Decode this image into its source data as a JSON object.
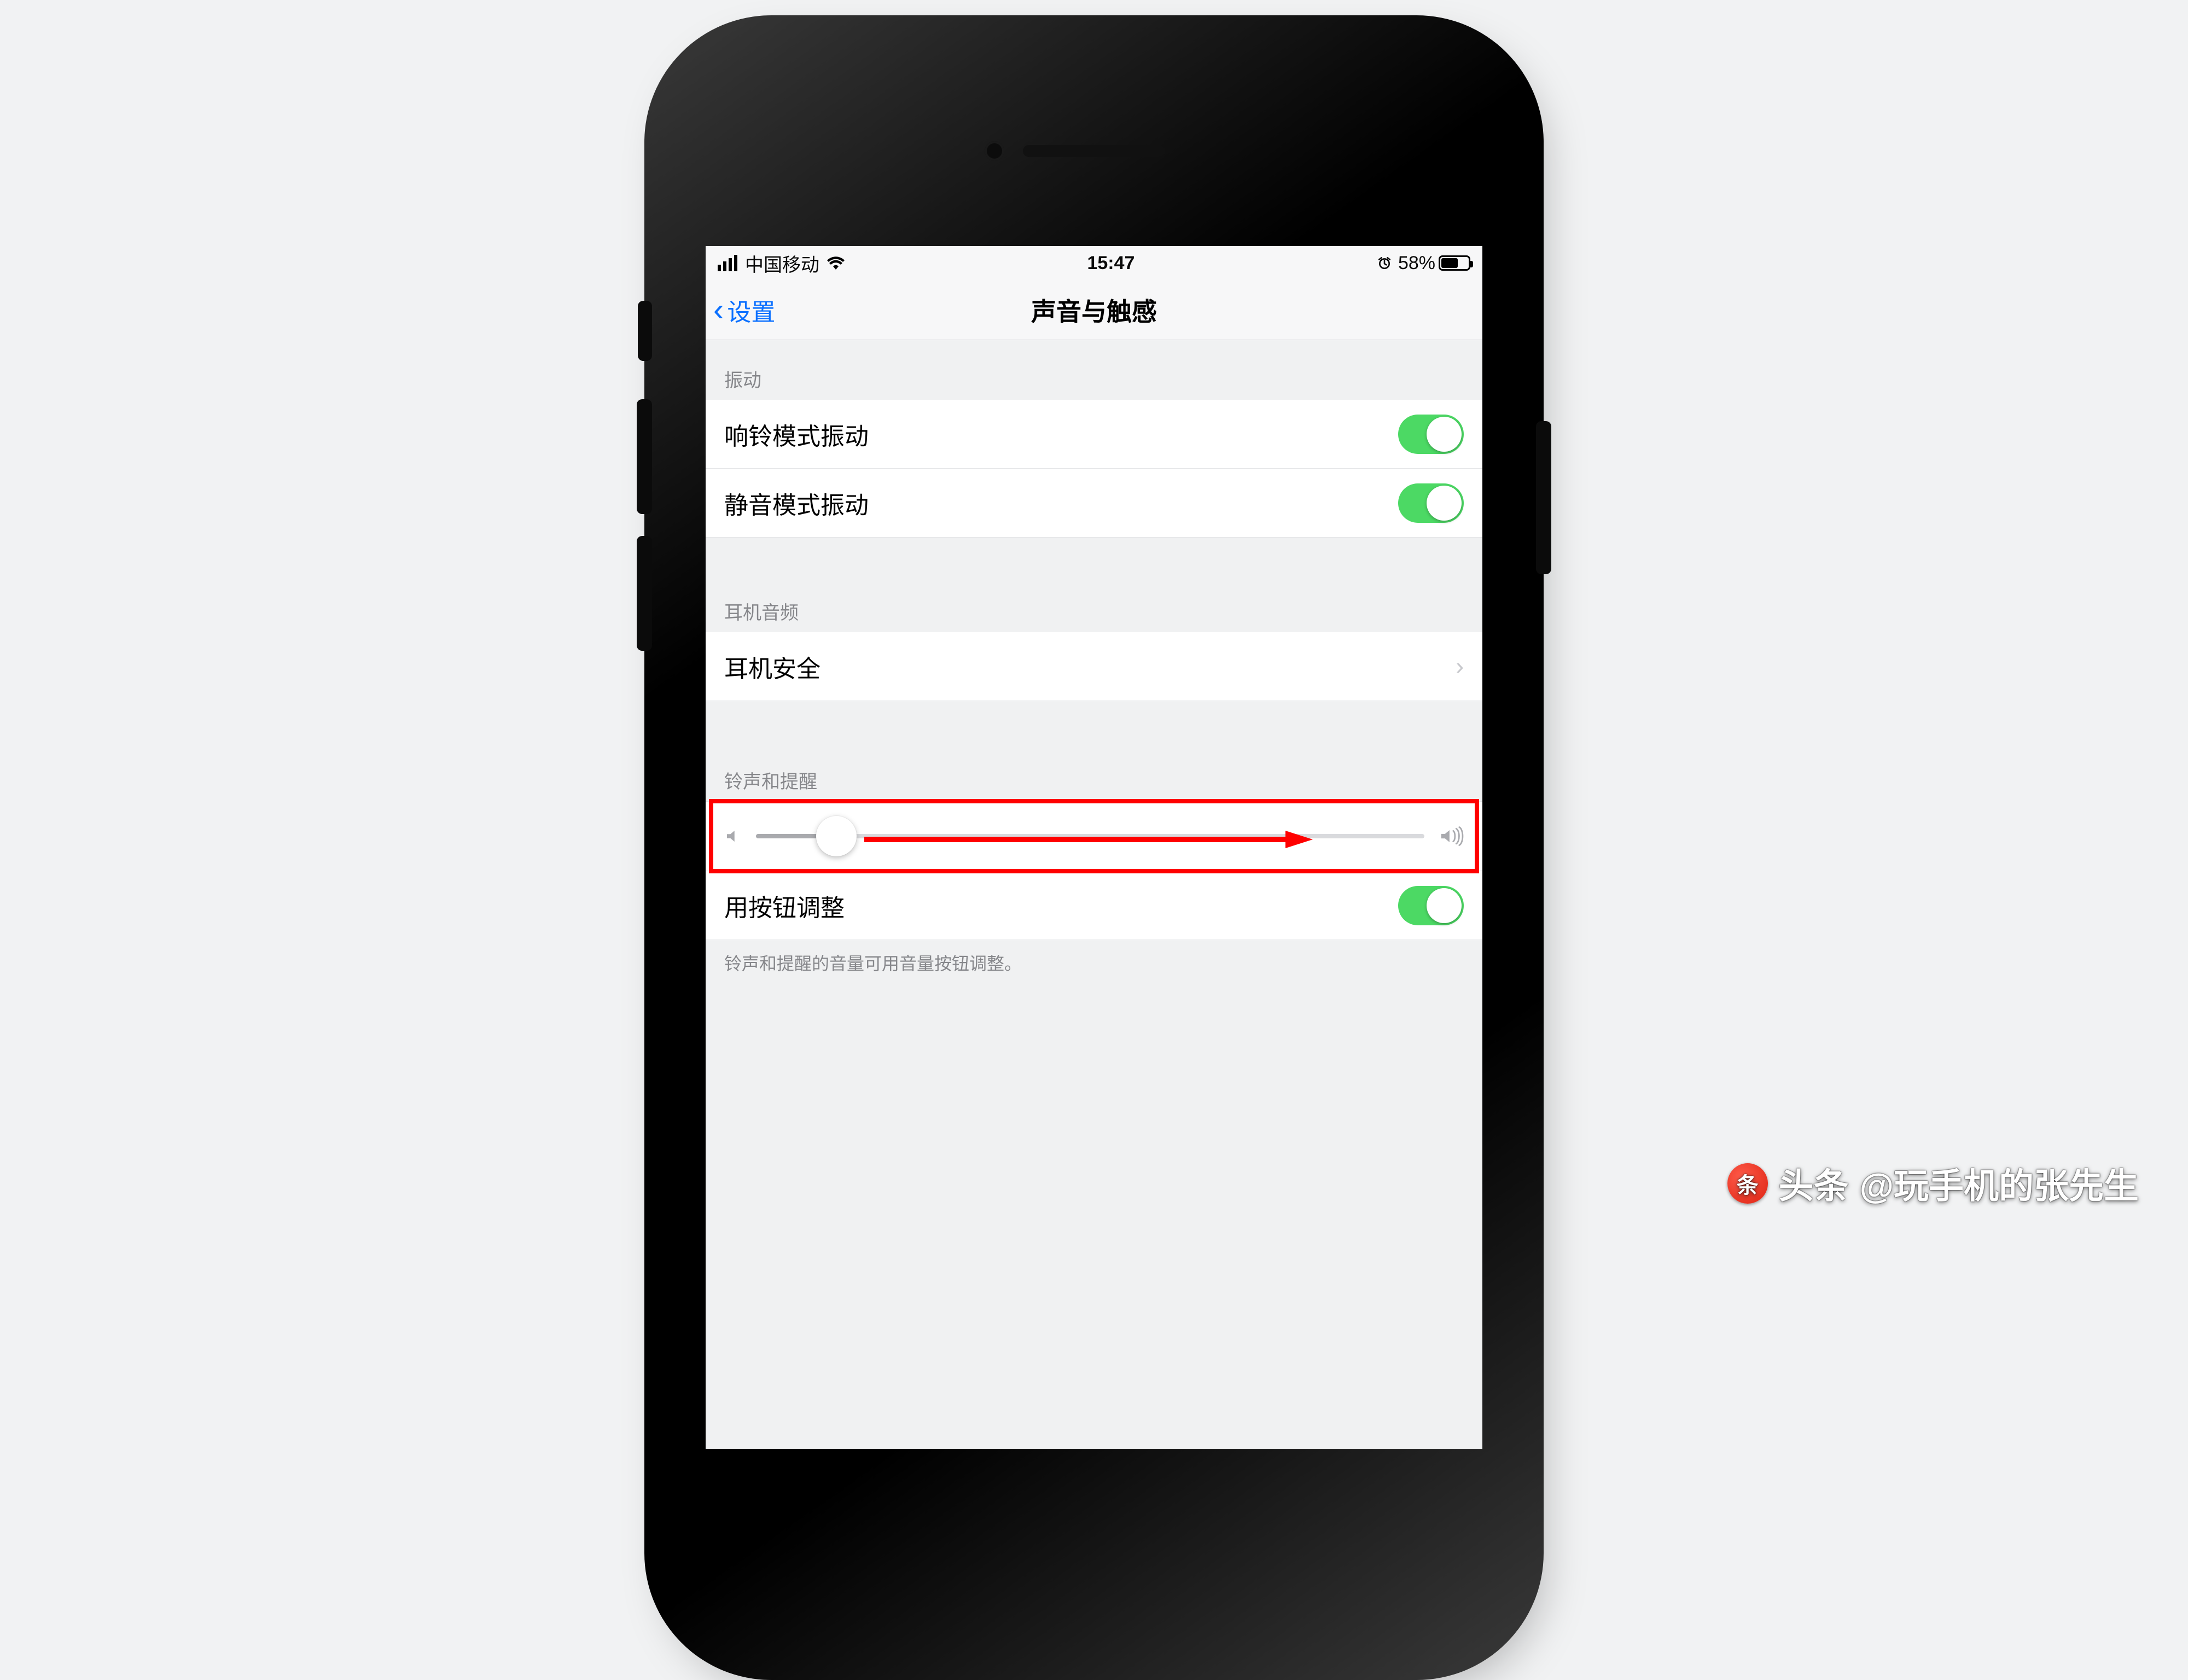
{
  "statusbar": {
    "carrier": "中国移动",
    "time": "15:47",
    "battery_pct": "58%"
  },
  "nav": {
    "back_label": "设置",
    "title": "声音与触感"
  },
  "sections": {
    "vibrate_header": "振动",
    "ring_vibrate": "响铃模式振动",
    "silent_vibrate": "静音模式振动",
    "headphone_header": "耳机音频",
    "headphone_safety": "耳机安全",
    "ringer_header": "铃声和提醒",
    "button_adjust": "用按钮调整",
    "button_adjust_footer": "铃声和提醒的音量可用音量按钮调整。"
  },
  "toggles": {
    "ring_vibrate": true,
    "silent_vibrate": true,
    "button_adjust": true
  },
  "slider": {
    "value_pct": 12
  },
  "annotation": {
    "highlight_color": "#ff0000"
  },
  "watermark": {
    "source": "头条",
    "handle": "@玩手机的张先生"
  }
}
